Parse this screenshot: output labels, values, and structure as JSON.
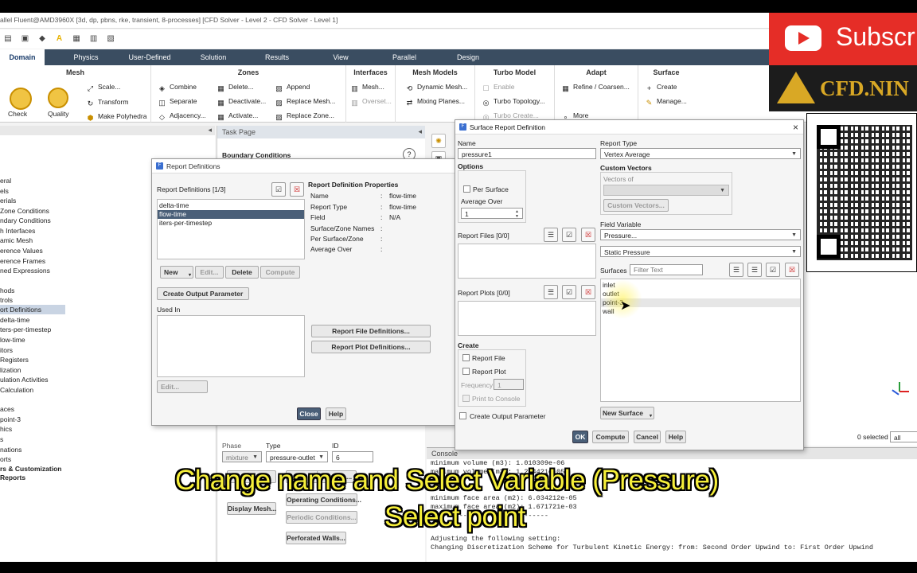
{
  "window_title": "allel Fluent@AMD3960X  [3d, dp, pbns, rke, transient, 8-processes] [CFD Solver - Level 2 - CFD Solver - Level 1]",
  "tabs": [
    "Domain",
    "Physics",
    "User-Defined",
    "Solution",
    "Results",
    "View",
    "Parallel",
    "Design"
  ],
  "ribbon": {
    "mesh_title": "Mesh",
    "mesh_items": [
      "Check",
      "Quality",
      "Scale...",
      "Transform",
      "Make Polyhedra"
    ],
    "zones_title": "Zones",
    "zones_items": [
      "Combine",
      "Separate",
      "Adjacency...",
      "Delete...",
      "Deactivate...",
      "Activate...",
      "Append",
      "Replace Mesh...",
      "Replace Zone..."
    ],
    "interfaces_title": "Interfaces",
    "interfaces_items": [
      "Mesh...",
      "Overset..."
    ],
    "mesh_models_title": "Mesh Models",
    "mesh_models_items": [
      "Dynamic Mesh...",
      "Mixing Planes..."
    ],
    "turbo_title": "Turbo Model",
    "turbo_items": [
      "Enable",
      "Turbo Topology...",
      "Turbo Create..."
    ],
    "adapt_title": "Adapt",
    "adapt_items": [
      "Refine / Coarsen...",
      "More"
    ],
    "surface_title": "Surface",
    "surface_items": [
      "Create",
      "Manage..."
    ]
  },
  "tree": {
    "items": [
      "eral",
      "els",
      "erials",
      "Zone Conditions",
      "ndary Conditions",
      "h Interfaces",
      "amic Mesh",
      "erence Values",
      "erence Frames",
      "ned Expressions",
      "",
      "hods",
      "trols",
      "ort Definitions",
      "delta-time",
      "ters-per-timestep",
      "low-time",
      "itors",
      "Registers",
      "lization",
      "ulation Activities",
      "Calculation",
      "",
      "aces",
      "point-3",
      "hics",
      "s",
      "nations",
      "orts",
      "rs & Customization",
      "Reports"
    ]
  },
  "task_page": {
    "header": "Task Page",
    "title": "Boundary Conditions",
    "phase_label": "Phase",
    "phase_value": "mixture",
    "type_label": "Type",
    "type_value": "pressure-outlet",
    "id_label": "ID",
    "id_value": "6",
    "edit": "Edit...",
    "copy": "Copy...",
    "profiles": "Profiles...",
    "display_mesh": "Display Mesh...",
    "operating": "Operating Conditions...",
    "periodic": "Periodic Conditions...",
    "perforated": "Perforated Walls..."
  },
  "report_defs": {
    "title": "Report Definitions",
    "list_label": "Report Definitions",
    "count": "[1/3]",
    "items": [
      "delta-time",
      "flow-time",
      "iters-per-timestep"
    ],
    "props_title": "Report Definition Properties",
    "props": [
      {
        "k": "Name",
        "v": "flow-time"
      },
      {
        "k": "Report Type",
        "v": "flow-time"
      },
      {
        "k": "Field",
        "v": "N/A"
      },
      {
        "k": "Surface/Zone Names",
        "v": ""
      },
      {
        "k": "Per Surface/Zone",
        "v": ""
      },
      {
        "k": "Average Over",
        "v": ""
      }
    ],
    "new": "New",
    "edit": "Edit...",
    "delete": "Delete",
    "compute": "Compute",
    "create_output": "Create Output Parameter",
    "used_in": "Used In",
    "edit2": "Edit...",
    "file_defs": "Report File Definitions...",
    "plot_defs": "Report Plot Definitions...",
    "close": "Close",
    "help": "Help"
  },
  "surface_report": {
    "title": "Surface Report Definition",
    "name_label": "Name",
    "name_value": "pressure1",
    "options_label": "Options",
    "per_surface": "Per Surface",
    "average_over": "Average Over",
    "average_value": "1",
    "report_files": "Report Files",
    "report_files_count": "[0/0]",
    "report_plots": "Report Plots",
    "report_plots_count": "[0/0]",
    "create_label": "Create",
    "report_file": "Report File",
    "report_plot": "Report Plot",
    "frequency_label": "Frequency",
    "frequency_value": "1",
    "print_console": "Print to Console",
    "create_output": "Create Output Parameter",
    "report_type_label": "Report Type",
    "report_type_value": "Vertex Average",
    "custom_vectors": "Custom Vectors",
    "vectors_of": "Vectors of",
    "custom_vectors_btn": "Custom Vectors...",
    "field_variable": "Field Variable",
    "field_value": "Pressure...",
    "field_sub_value": "Static Pressure",
    "surfaces_label": "Surfaces",
    "filter_placeholder": "Filter Text",
    "surfaces": [
      "inlet",
      "outlet",
      "point-3",
      "wall"
    ],
    "new_surface": "New Surface",
    "ok": "OK",
    "compute": "Compute",
    "cancel": "Cancel",
    "help": "Help"
  },
  "console": {
    "header": "Console",
    "lines": [
      "minimum volume (m3): 1.010309e-06",
      "maximum volume (m3): 1.294421e-05",
      "",
      "",
      "minimum face area (m2): 6.034212e-05",
      "maximum face area (m2): 1.671721e-03",
      "",
      "",
      "Adjusting the following setting:",
      "Changing Discretization Scheme for Turbulent Kinetic Energy:   from: Second Order Upwind   to: First Order Upwind"
    ],
    "dots": "-----------------------------"
  },
  "graphics": {
    "selected": "0 selected",
    "filter": "all"
  },
  "overlay": {
    "yt_text": "Subscr",
    "brand": "CFD.NIN",
    "subtitle_line1": "Change name and Select Variable (Pressure)",
    "subtitle_line2": "Select point"
  }
}
